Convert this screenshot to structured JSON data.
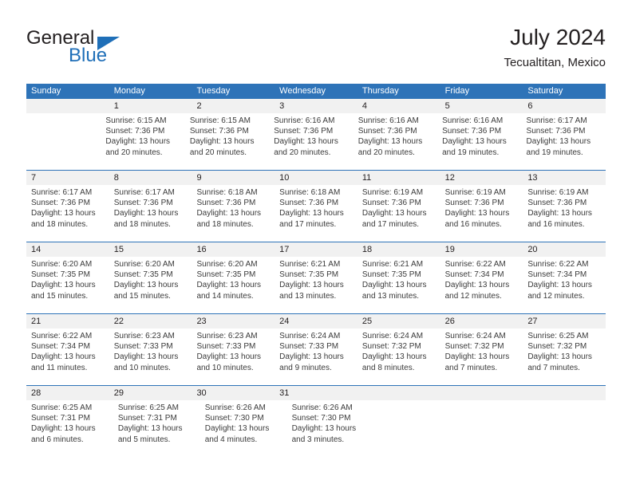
{
  "brand": {
    "word_one": "General",
    "word_two": "Blue",
    "triangle_icon": "blue-triangle-icon",
    "accent_color": "#1f6fb8"
  },
  "header": {
    "title": "July 2024",
    "subtitle": "Tecualtitan, Mexico"
  },
  "theme": {
    "header_blue": "#2e73b8",
    "date_band": "#f1f1f1",
    "body_bg": "#ffffff",
    "text": "#3a3a3a"
  },
  "calendar": {
    "day_headers": [
      "Sunday",
      "Monday",
      "Tuesday",
      "Wednesday",
      "Thursday",
      "Friday",
      "Saturday"
    ],
    "weeks": [
      {
        "days": [
          {
            "date": "",
            "lines": []
          },
          {
            "date": "1",
            "lines": [
              "Sunrise: 6:15 AM",
              "Sunset: 7:36 PM",
              "Daylight: 13 hours",
              "and 20 minutes."
            ]
          },
          {
            "date": "2",
            "lines": [
              "Sunrise: 6:15 AM",
              "Sunset: 7:36 PM",
              "Daylight: 13 hours",
              "and 20 minutes."
            ]
          },
          {
            "date": "3",
            "lines": [
              "Sunrise: 6:16 AM",
              "Sunset: 7:36 PM",
              "Daylight: 13 hours",
              "and 20 minutes."
            ]
          },
          {
            "date": "4",
            "lines": [
              "Sunrise: 6:16 AM",
              "Sunset: 7:36 PM",
              "Daylight: 13 hours",
              "and 20 minutes."
            ]
          },
          {
            "date": "5",
            "lines": [
              "Sunrise: 6:16 AM",
              "Sunset: 7:36 PM",
              "Daylight: 13 hours",
              "and 19 minutes."
            ]
          },
          {
            "date": "6",
            "lines": [
              "Sunrise: 6:17 AM",
              "Sunset: 7:36 PM",
              "Daylight: 13 hours",
              "and 19 minutes."
            ]
          }
        ]
      },
      {
        "days": [
          {
            "date": "7",
            "lines": [
              "Sunrise: 6:17 AM",
              "Sunset: 7:36 PM",
              "Daylight: 13 hours",
              "and 18 minutes."
            ]
          },
          {
            "date": "8",
            "lines": [
              "Sunrise: 6:17 AM",
              "Sunset: 7:36 PM",
              "Daylight: 13 hours",
              "and 18 minutes."
            ]
          },
          {
            "date": "9",
            "lines": [
              "Sunrise: 6:18 AM",
              "Sunset: 7:36 PM",
              "Daylight: 13 hours",
              "and 18 minutes."
            ]
          },
          {
            "date": "10",
            "lines": [
              "Sunrise: 6:18 AM",
              "Sunset: 7:36 PM",
              "Daylight: 13 hours",
              "and 17 minutes."
            ]
          },
          {
            "date": "11",
            "lines": [
              "Sunrise: 6:19 AM",
              "Sunset: 7:36 PM",
              "Daylight: 13 hours",
              "and 17 minutes."
            ]
          },
          {
            "date": "12",
            "lines": [
              "Sunrise: 6:19 AM",
              "Sunset: 7:36 PM",
              "Daylight: 13 hours",
              "and 16 minutes."
            ]
          },
          {
            "date": "13",
            "lines": [
              "Sunrise: 6:19 AM",
              "Sunset: 7:36 PM",
              "Daylight: 13 hours",
              "and 16 minutes."
            ]
          }
        ]
      },
      {
        "days": [
          {
            "date": "14",
            "lines": [
              "Sunrise: 6:20 AM",
              "Sunset: 7:35 PM",
              "Daylight: 13 hours",
              "and 15 minutes."
            ]
          },
          {
            "date": "15",
            "lines": [
              "Sunrise: 6:20 AM",
              "Sunset: 7:35 PM",
              "Daylight: 13 hours",
              "and 15 minutes."
            ]
          },
          {
            "date": "16",
            "lines": [
              "Sunrise: 6:20 AM",
              "Sunset: 7:35 PM",
              "Daylight: 13 hours",
              "and 14 minutes."
            ]
          },
          {
            "date": "17",
            "lines": [
              "Sunrise: 6:21 AM",
              "Sunset: 7:35 PM",
              "Daylight: 13 hours",
              "and 13 minutes."
            ]
          },
          {
            "date": "18",
            "lines": [
              "Sunrise: 6:21 AM",
              "Sunset: 7:35 PM",
              "Daylight: 13 hours",
              "and 13 minutes."
            ]
          },
          {
            "date": "19",
            "lines": [
              "Sunrise: 6:22 AM",
              "Sunset: 7:34 PM",
              "Daylight: 13 hours",
              "and 12 minutes."
            ]
          },
          {
            "date": "20",
            "lines": [
              "Sunrise: 6:22 AM",
              "Sunset: 7:34 PM",
              "Daylight: 13 hours",
              "and 12 minutes."
            ]
          }
        ]
      },
      {
        "days": [
          {
            "date": "21",
            "lines": [
              "Sunrise: 6:22 AM",
              "Sunset: 7:34 PM",
              "Daylight: 13 hours",
              "and 11 minutes."
            ]
          },
          {
            "date": "22",
            "lines": [
              "Sunrise: 6:23 AM",
              "Sunset: 7:33 PM",
              "Daylight: 13 hours",
              "and 10 minutes."
            ]
          },
          {
            "date": "23",
            "lines": [
              "Sunrise: 6:23 AM",
              "Sunset: 7:33 PM",
              "Daylight: 13 hours",
              "and 10 minutes."
            ]
          },
          {
            "date": "24",
            "lines": [
              "Sunrise: 6:24 AM",
              "Sunset: 7:33 PM",
              "Daylight: 13 hours",
              "and 9 minutes."
            ]
          },
          {
            "date": "25",
            "lines": [
              "Sunrise: 6:24 AM",
              "Sunset: 7:32 PM",
              "Daylight: 13 hours",
              "and 8 minutes."
            ]
          },
          {
            "date": "26",
            "lines": [
              "Sunrise: 6:24 AM",
              "Sunset: 7:32 PM",
              "Daylight: 13 hours",
              "and 7 minutes."
            ]
          },
          {
            "date": "27",
            "lines": [
              "Sunrise: 6:25 AM",
              "Sunset: 7:32 PM",
              "Daylight: 13 hours",
              "and 7 minutes."
            ]
          }
        ]
      },
      {
        "days": [
          {
            "date": "28",
            "lines": [
              "Sunrise: 6:25 AM",
              "Sunset: 7:31 PM",
              "Daylight: 13 hours",
              "and 6 minutes."
            ]
          },
          {
            "date": "29",
            "lines": [
              "Sunrise: 6:25 AM",
              "Sunset: 7:31 PM",
              "Daylight: 13 hours",
              "and 5 minutes."
            ]
          },
          {
            "date": "30",
            "lines": [
              "Sunrise: 6:26 AM",
              "Sunset: 7:30 PM",
              "Daylight: 13 hours",
              "and 4 minutes."
            ]
          },
          {
            "date": "31",
            "lines": [
              "Sunrise: 6:26 AM",
              "Sunset: 7:30 PM",
              "Daylight: 13 hours",
              "and 3 minutes."
            ]
          },
          {
            "date": "",
            "lines": []
          },
          {
            "date": "",
            "lines": []
          },
          {
            "date": "",
            "lines": []
          }
        ]
      }
    ]
  }
}
